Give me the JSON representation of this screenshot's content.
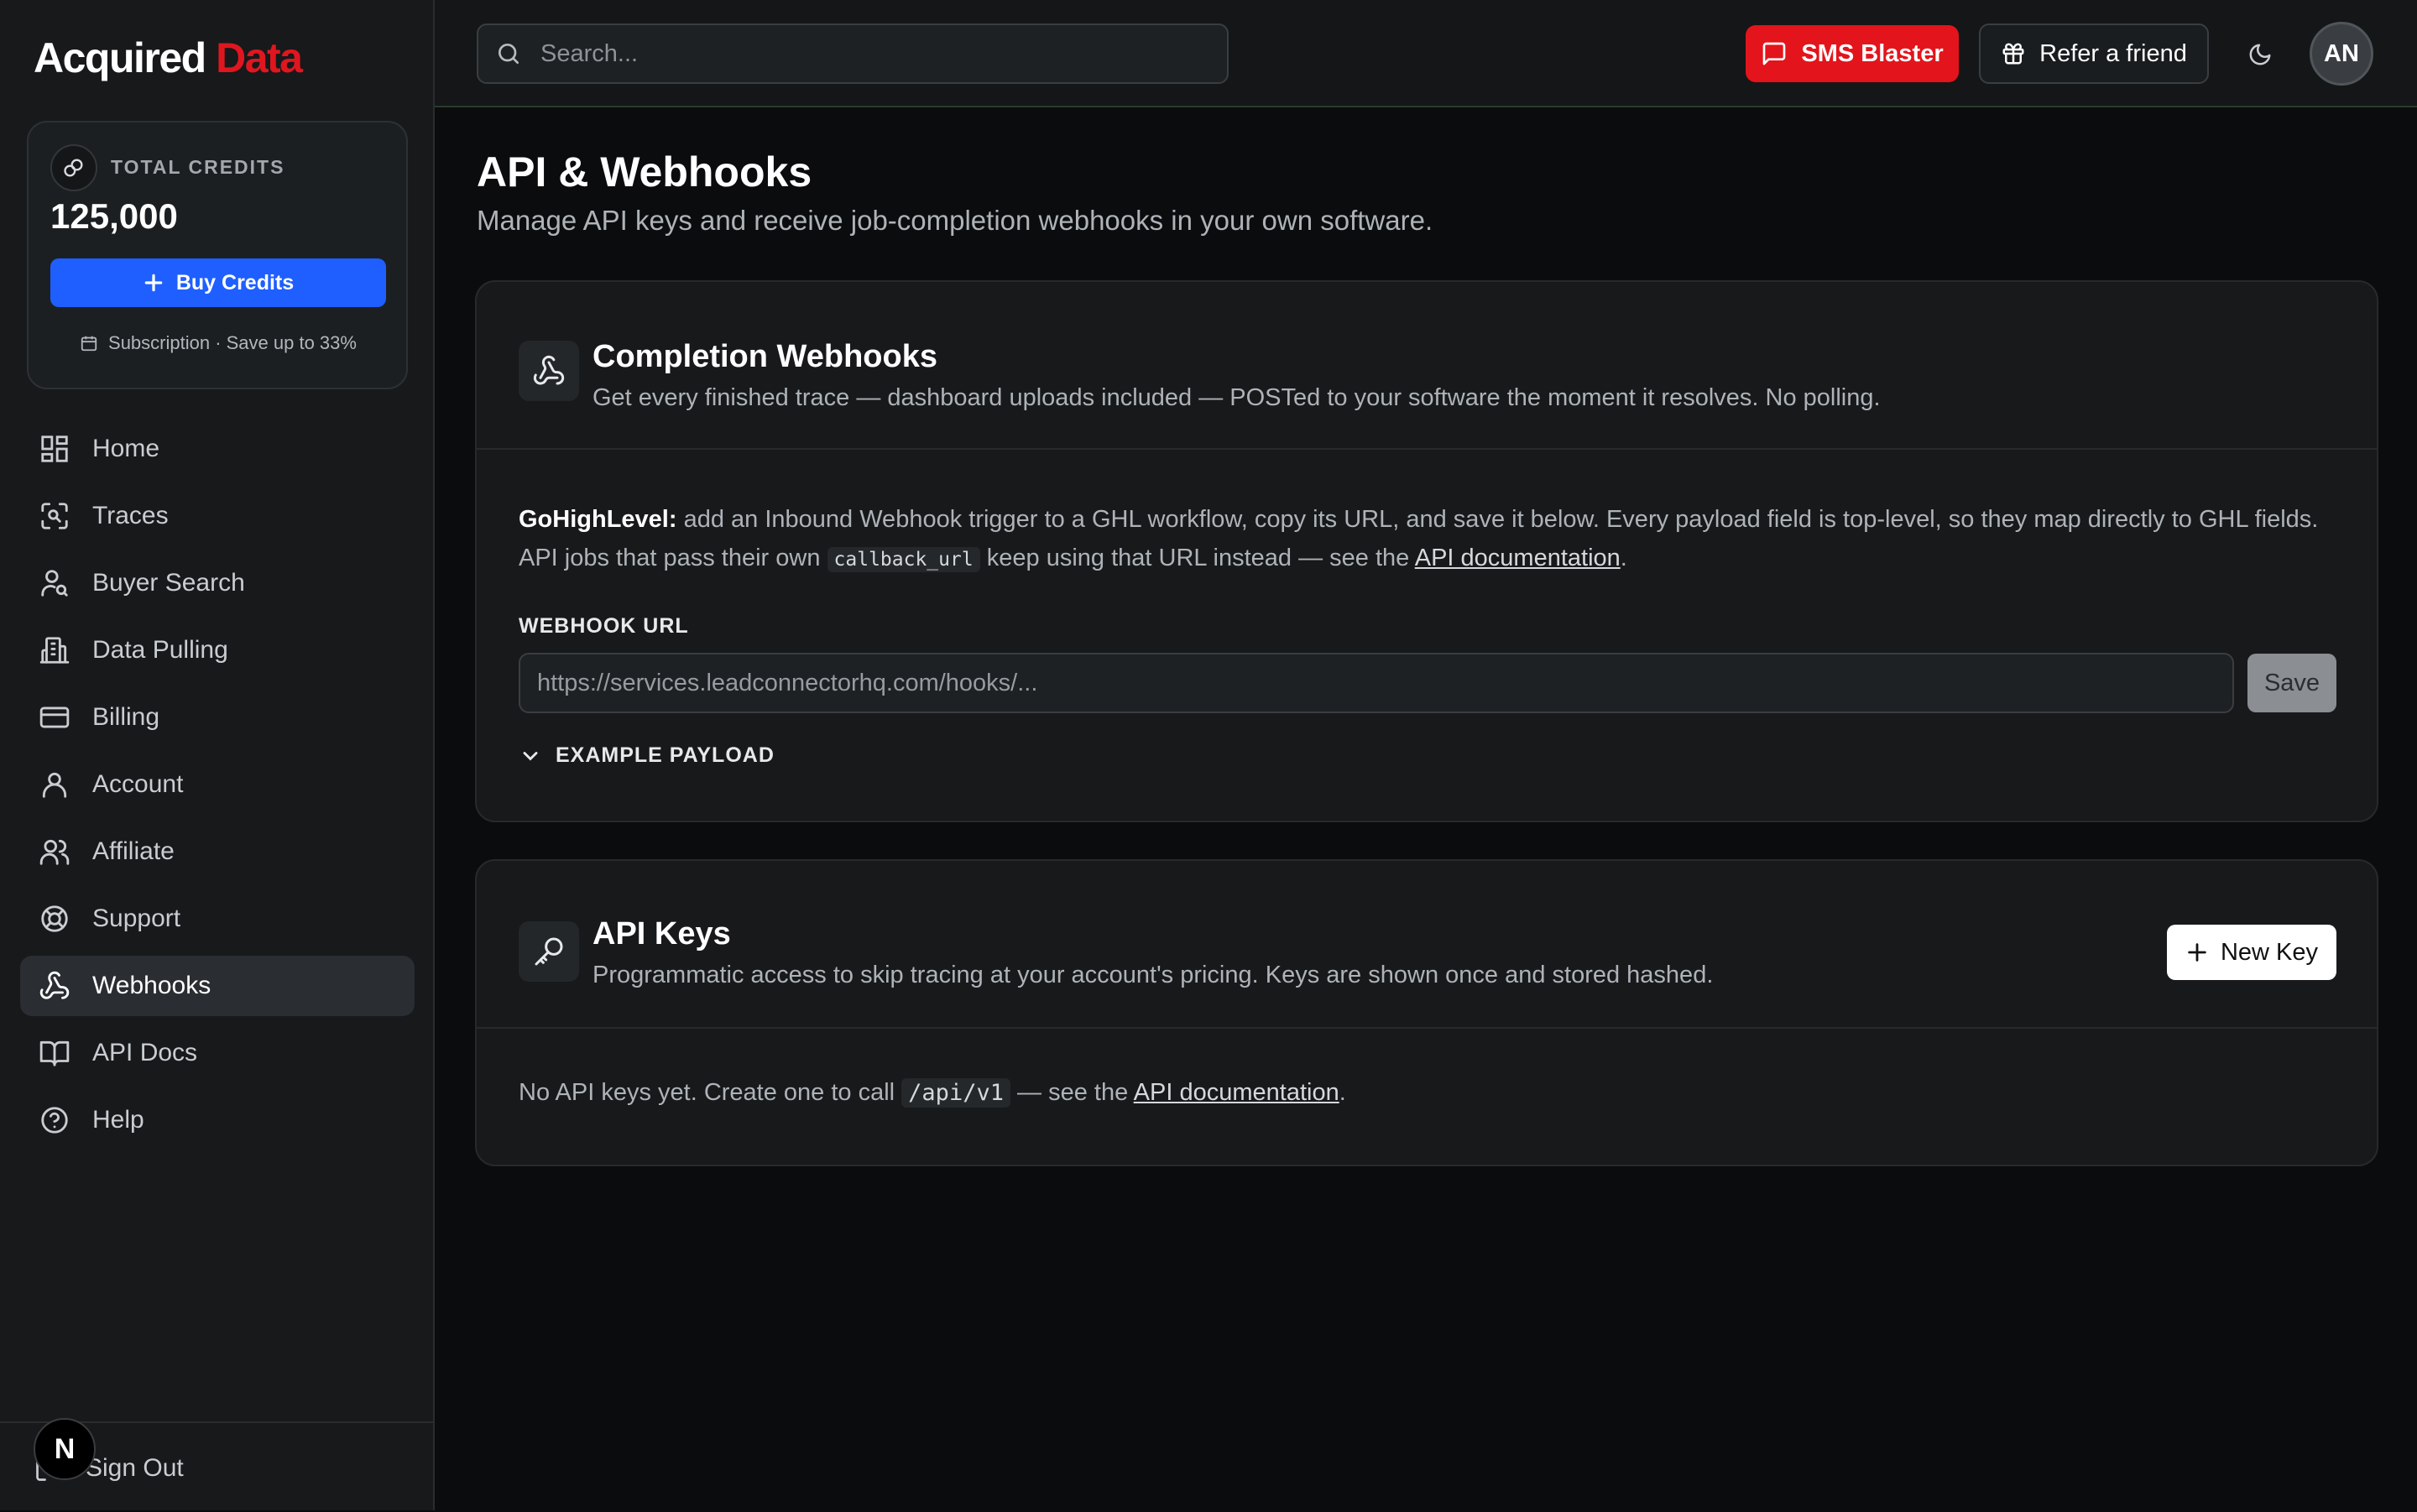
{
  "brand": {
    "part1": "Acquired",
    "part2": "Data"
  },
  "credits": {
    "label": "TOTAL CREDITS",
    "value": "125,000",
    "buy_label": "Buy Credits",
    "subscription_text": "Subscription · Save up to 33%"
  },
  "sidebar": {
    "items": [
      {
        "label": "Home",
        "icon": "grid-icon"
      },
      {
        "label": "Traces",
        "icon": "scan-icon"
      },
      {
        "label": "Buyer Search",
        "icon": "user-search-icon"
      },
      {
        "label": "Data Pulling",
        "icon": "building-icon"
      },
      {
        "label": "Billing",
        "icon": "credit-card-icon"
      },
      {
        "label": "Account",
        "icon": "user-icon"
      },
      {
        "label": "Affiliate",
        "icon": "users-icon"
      },
      {
        "label": "Support",
        "icon": "life-buoy-icon"
      },
      {
        "label": "Webhooks",
        "icon": "webhook-icon",
        "active": true
      },
      {
        "label": "API Docs",
        "icon": "book-icon"
      },
      {
        "label": "Help",
        "icon": "help-circle-icon"
      }
    ],
    "sign_out": "Sign Out",
    "dev_badge": "N"
  },
  "header": {
    "search_placeholder": "Search...",
    "sms_label": "SMS Blaster",
    "refer_label": "Refer a friend",
    "avatar_initials": "AN"
  },
  "page": {
    "title": "API & Webhooks",
    "subtitle": "Manage API keys and receive job-completion webhooks in your own software."
  },
  "webhooks_card": {
    "title": "Completion Webhooks",
    "description": "Get every finished trace — dashboard uploads included — POSTed to your software the moment it resolves. No polling.",
    "ghl_bold": "GoHighLevel:",
    "ghl_text1": " add an Inbound Webhook trigger to a GHL workflow, copy its URL, and save it below. Every payload field is top-level, so they map directly to GHL fields. API jobs that pass their own ",
    "ghl_code": "callback_url",
    "ghl_text2": " keep using that URL instead — see the ",
    "ghl_link": "API documentation",
    "ghl_end": ".",
    "field_label": "WEBHOOK URL",
    "url_placeholder": "https://services.leadconnectorhq.com/hooks/...",
    "save_label": "Save",
    "payload_label": "EXAMPLE PAYLOAD"
  },
  "apikeys_card": {
    "title": "API Keys",
    "description": "Programmatic access to skip tracing at your account's pricing. Keys are shown once and stored hashed.",
    "new_key_label": "New Key",
    "empty_text1": "No API keys yet. Create one to call ",
    "empty_code": "/api/v1",
    "empty_text2": " — see the ",
    "empty_link": "API documentation",
    "empty_end": "."
  },
  "colors": {
    "accent_blue": "#1f5fff",
    "brand_red": "#e0161f",
    "sms_red": "#e3141b",
    "background": "#0b0c0d"
  }
}
